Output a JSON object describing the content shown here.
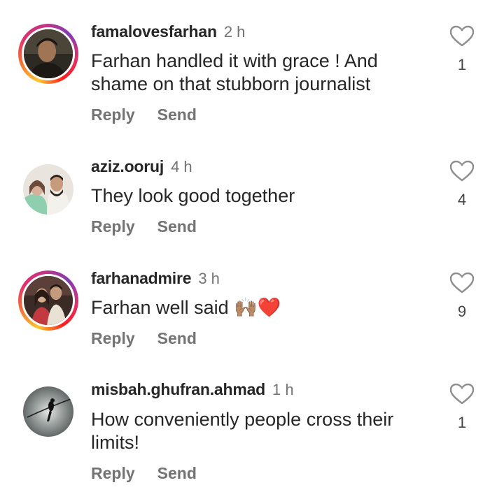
{
  "comments": [
    {
      "username": "famalovesfarhan",
      "time": "2 h",
      "text": "Farhan handled it with grace ! And shame on that stubborn journalist",
      "likes": "1",
      "has_story_ring": true
    },
    {
      "username": "aziz.ooruj",
      "time": "4 h",
      "text": "They look good together",
      "likes": "4",
      "has_story_ring": false
    },
    {
      "username": "farhanadmire",
      "time": "3 h",
      "text": "Farhan well said 🙌🏽❤️",
      "likes": "9",
      "has_story_ring": true
    },
    {
      "username": "misbah.ghufran.ahmad",
      "time": "1 h",
      "text": "How conveniently people cross their limits!",
      "likes": "1",
      "has_story_ring": false
    }
  ],
  "actions": {
    "reply_label": "Reply",
    "send_label": "Send"
  },
  "icons": {
    "like": "heart-outline-icon"
  },
  "colors": {
    "text": "#262626",
    "secondary": "#737373",
    "background": "#ffffff"
  }
}
